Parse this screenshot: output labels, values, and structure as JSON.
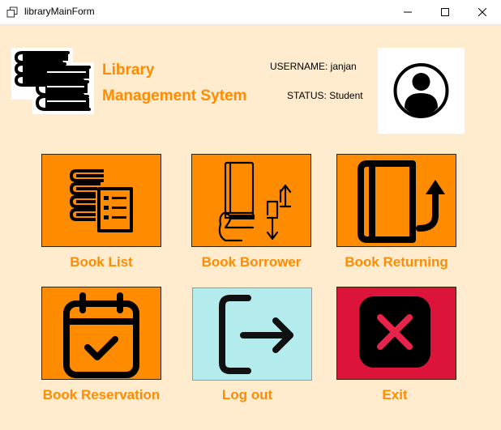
{
  "window": {
    "title": "libraryMainForm",
    "controls": {
      "minimize": "minimize",
      "maximize": "maximize",
      "close": "close"
    }
  },
  "header": {
    "title_line1": "Library",
    "title_line2": "Management Sytem",
    "username_text": "USERNAME: janjan",
    "status_text": "STATUS: Student",
    "logo_icon": "stacked-books-icon",
    "avatar_icon": "user-avatar-icon"
  },
  "tiles": [
    {
      "label": "Book List",
      "icon": "book-list-icon",
      "color": "#FF8C00"
    },
    {
      "label": "Book Borrower",
      "icon": "book-borrow-icon",
      "color": "#FF8C00"
    },
    {
      "label": "Book Returning",
      "icon": "book-return-icon",
      "color": "#FF8C00"
    },
    {
      "label": "Book Reservation",
      "icon": "calendar-check-icon",
      "color": "#FF8C00"
    },
    {
      "label": "Log out",
      "icon": "logout-icon",
      "color": "#B4ECEE"
    },
    {
      "label": "Exit",
      "icon": "exit-x-icon",
      "color": "#DC143C"
    }
  ],
  "colors": {
    "background": "#FFEBCD",
    "accent": "#FF8C00",
    "logout_tile": "#B4ECEE",
    "exit_tile": "#DC143C",
    "exit_x": "#E8234A"
  }
}
